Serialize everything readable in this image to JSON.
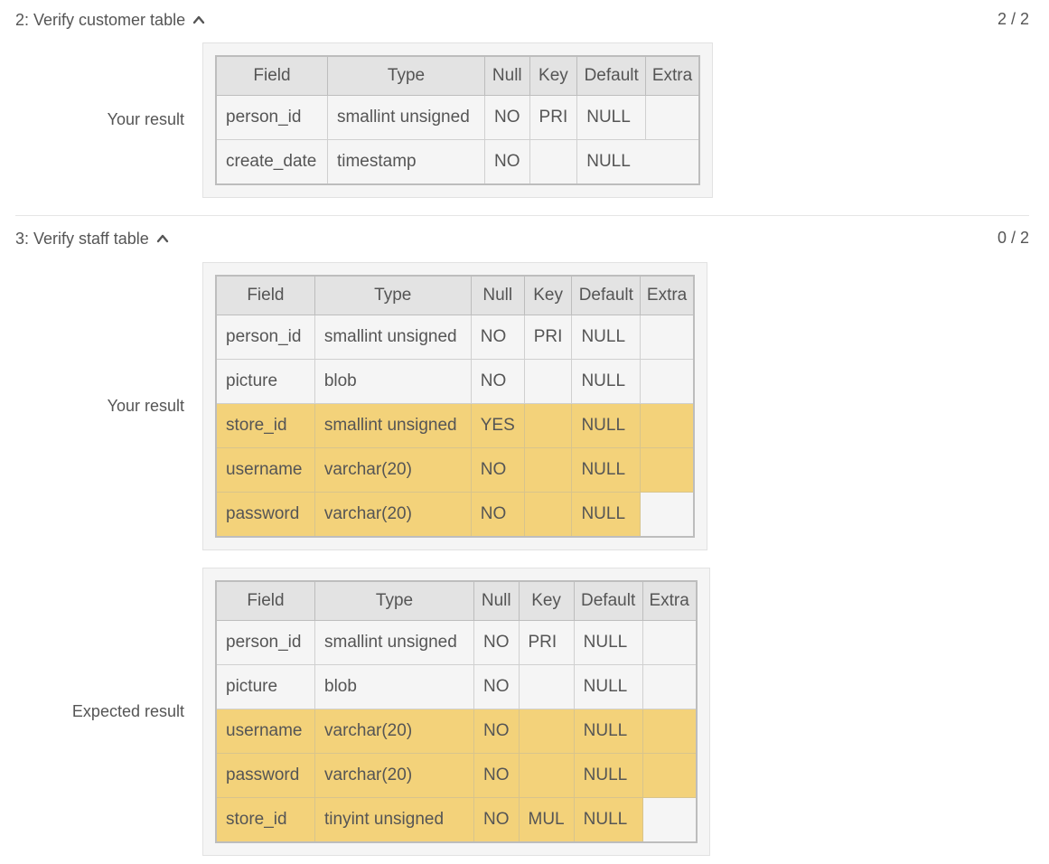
{
  "section2": {
    "title": "2: Verify customer table",
    "score": "2 / 2",
    "your_label": "Your result",
    "columns": [
      "Field",
      "Type",
      "Null",
      "Key",
      "Default",
      "Extra"
    ],
    "rows": [
      [
        "person_id",
        "smallint unsigned",
        "NO",
        "PRI",
        "NULL",
        ""
      ],
      [
        "create_date",
        "timestamp",
        "NO",
        "",
        "NULL",
        ""
      ]
    ]
  },
  "section3": {
    "title": "3: Verify staff table",
    "score": "0 / 2",
    "your_label": "Your result",
    "expected_label": "Expected result",
    "columns": [
      "Field",
      "Type",
      "Null",
      "Key",
      "Default",
      "Extra"
    ],
    "your_rows": [
      [
        "person_id",
        "smallint unsigned",
        "NO",
        "PRI",
        "NULL",
        ""
      ],
      [
        "picture",
        "blob",
        "NO",
        "",
        "NULL",
        ""
      ],
      [
        "store_id",
        "smallint unsigned",
        "YES",
        "",
        "NULL",
        ""
      ],
      [
        "username",
        "varchar(20)",
        "NO",
        "",
        "NULL",
        ""
      ],
      [
        "password",
        "varchar(20)",
        "NO",
        "",
        "NULL",
        ""
      ]
    ],
    "expected_rows": [
      [
        "person_id",
        "smallint unsigned",
        "NO",
        "PRI",
        "NULL",
        ""
      ],
      [
        "picture",
        "blob",
        "NO",
        "",
        "NULL",
        ""
      ],
      [
        "username",
        "varchar(20)",
        "NO",
        "",
        "NULL",
        ""
      ],
      [
        "password",
        "varchar(20)",
        "NO",
        "",
        "NULL",
        ""
      ],
      [
        "store_id",
        "tinyint unsigned",
        "NO",
        "MUL",
        "NULL",
        ""
      ]
    ]
  },
  "colors": {
    "highlight": "#f3d27a",
    "cell_bg": "#f5f5f5",
    "header_bg": "#e3e3e3"
  }
}
